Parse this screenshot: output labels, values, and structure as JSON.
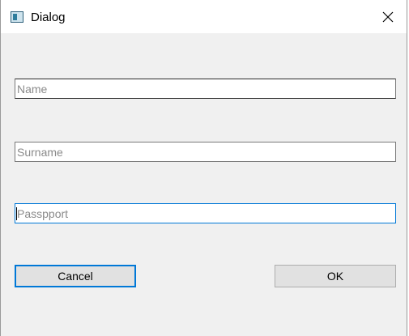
{
  "window": {
    "title": "Dialog",
    "icon": "app-window-icon"
  },
  "form": {
    "name": {
      "placeholder": "Name",
      "value": ""
    },
    "surname": {
      "placeholder": "Surname",
      "value": ""
    },
    "passport": {
      "placeholder": "Passpport",
      "value": ""
    }
  },
  "buttons": {
    "cancel_label": "Cancel",
    "ok_label": "OK"
  },
  "colors": {
    "focus_accent": "#0078d7",
    "dialog_background": "#f0f0f0"
  }
}
